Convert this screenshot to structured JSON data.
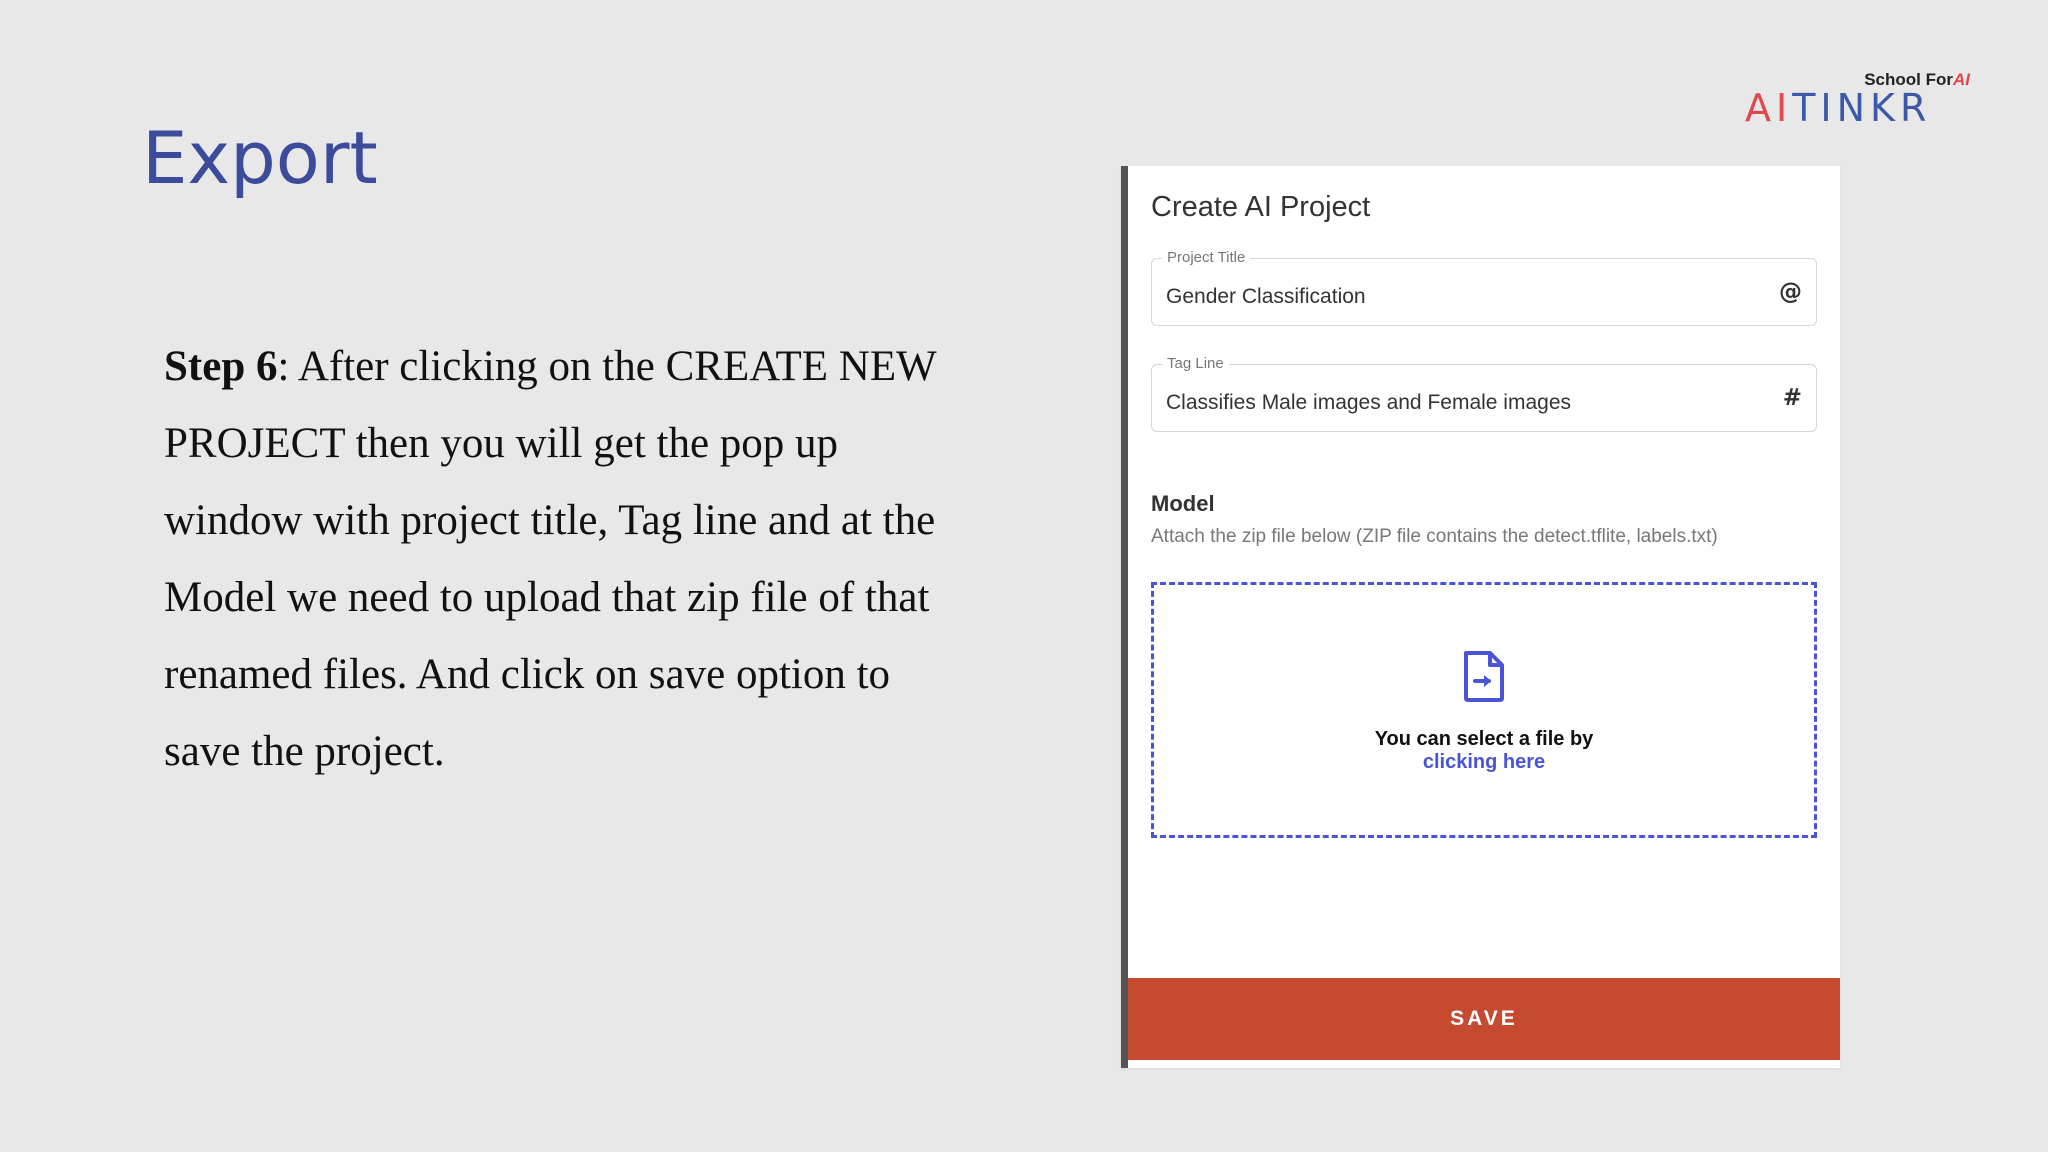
{
  "slide": {
    "title": "Export",
    "step_label": "Step 6",
    "step_colon": ":",
    "step_body": "  After clicking on the CREATE NEW PROJECT then you will get the pop up window with project title, Tag line and at the Model we need to upload that zip file of that renamed files. And click on save option to save the project."
  },
  "logo": {
    "sub_prefix": "School For",
    "sub_ai": "AI",
    "main_ai": "AI",
    "main_rest": "TINKR"
  },
  "dialog": {
    "title": "Create AI Project",
    "project_title": {
      "label": "Project Title",
      "value": "Gender Classification",
      "icon": "at-icon"
    },
    "tag_line": {
      "label": "Tag Line",
      "value": "Classifies Male images and Female images",
      "icon": "hash-icon"
    },
    "model": {
      "heading": "Model",
      "description": "Attach the zip file below (ZIP file contains the detect.tflite, labels.txt)"
    },
    "dropzone": {
      "icon": "file-upload-icon",
      "text": "You can select a file by",
      "link": "clicking here"
    },
    "save_label": "SAVE"
  },
  "colors": {
    "background": "#e8e8e8",
    "title": "#3c4b9a",
    "dropzone_accent": "#4a54d8",
    "save_button": "#c64a2f",
    "logo_red": "#e0484f",
    "logo_blue": "#3c59a8"
  }
}
